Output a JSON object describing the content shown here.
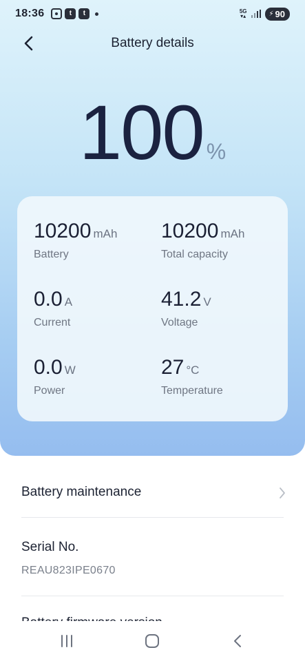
{
  "status_bar": {
    "time": "18:36",
    "notif_icons": [
      "screenshot-icon",
      "t-app-icon",
      "t-app-icon"
    ],
    "network": "5G",
    "battery_level": "90"
  },
  "header": {
    "title": "Battery details"
  },
  "battery": {
    "percent": "100",
    "percent_unit": "%"
  },
  "stats": {
    "battery": {
      "value": "10200",
      "unit": "mAh",
      "label": "Battery"
    },
    "total_capacity": {
      "value": "10200",
      "unit": "mAh",
      "label": "Total capacity"
    },
    "current": {
      "value": "0.0",
      "unit": "A",
      "label": "Current"
    },
    "voltage": {
      "value": "41.2",
      "unit": "V",
      "label": "Voltage"
    },
    "power": {
      "value": "0.0",
      "unit": "W",
      "label": "Power"
    },
    "temperature": {
      "value": "27",
      "unit": "°C",
      "label": "Temperature"
    }
  },
  "list": {
    "maintenance_label": "Battery maintenance",
    "serial_label": "Serial No.",
    "serial_value": "REAU823IPE0670",
    "partial_label": "Battery firmware version"
  },
  "colors": {
    "hero_top": "#dff3fb",
    "hero_bottom": "#95bdef",
    "text_primary": "#1b2240",
    "text_secondary": "#6f7683"
  }
}
